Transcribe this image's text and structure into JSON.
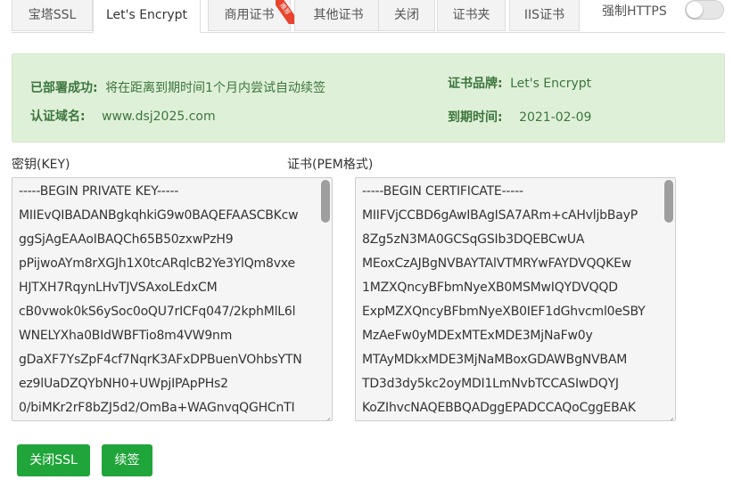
{
  "tabs": [
    {
      "label": "宝塔SSL",
      "active": false
    },
    {
      "label": "Let's Encrypt",
      "active": true
    },
    {
      "label": "商用证书",
      "active": false,
      "badge": "推荐"
    },
    {
      "label": "其他证书",
      "active": false
    },
    {
      "label": "关闭",
      "active": false
    },
    {
      "label": "证书夹",
      "active": false
    },
    {
      "label": "IIS证书",
      "active": false
    }
  ],
  "force_https": {
    "label": "强制HTTPS",
    "enabled": false
  },
  "info": {
    "deploy_key": "已部署成功:",
    "deploy_value": "将在距离到期时间1个月内尝试自动续签",
    "domain_key": "认证域名:",
    "domain_value": "www.dsj2025.com",
    "brand_key": "证书品牌:",
    "brand_value": "Let's Encrypt",
    "expire_key": "到期时间:",
    "expire_value": "2021-02-09"
  },
  "key_label": "密钥(KEY)",
  "cert_label": "证书(PEM格式)",
  "key_lines": [
    "-----BEGIN PRIVATE KEY-----",
    "MIIEvQIBADANBgkqhkiG9w0BAQEFAASCBKcw",
    "ggSjAgEAAoIBAQCh65B50zxwPzH9",
    "pPijwoAYm8rXGJh1X0tcARqlcB2Ye3YlQm8vxe",
    "HJTXH7RqynLHvTJVSAxoLEdxCM",
    "cB0vwok0kS6ySoc0oQU7rICFq047/2kphMlL6l",
    "WNELYXha0BIdWBFTio8m4VW9nm",
    "gDaXF7YsZpF4cf7NqrK3AFxDPBuenVOhbsYTN",
    "ez9lUaDZQYbNH0+UWpjIPApPHs2",
    "0/biMKr2rF8bZJ5d2/OmBa+WAGnvqQGHCnTI"
  ],
  "cert_lines": [
    "-----BEGIN CERTIFICATE-----",
    "MIIFVjCCBD6gAwIBAgISA7ARm+cAHvljbBayP",
    "8Zg5zN3MA0GCSqGSIb3DQEBCwUA",
    "MEoxCzAJBgNVBAYTAlVTMRYwFAYDVQQKEw",
    "1MZXQncyBFbmNyeXB0MSMwIQYDVQQD",
    "ExpMZXQncyBFbmNyeXB0IEF1dGhvcml0eSBY",
    "MzAeFw0yMDExMTExMDE3MjNaFw0y",
    "MTAyMDkxMDE3MjNaMBoxGDAWBgNVBAM",
    "TD3d3dy5kc2oyMDI1LmNvbTCCASIwDQYJ",
    "KoZIhvcNAQEBBQADggEPADCCAQoCggEBAK"
  ],
  "buttons": {
    "close_ssl": "关闭SSL",
    "renew": "续签"
  },
  "colors": {
    "accent": "#20a53a",
    "info_bg": "#dff0d8",
    "info_text": "#3c763d"
  }
}
